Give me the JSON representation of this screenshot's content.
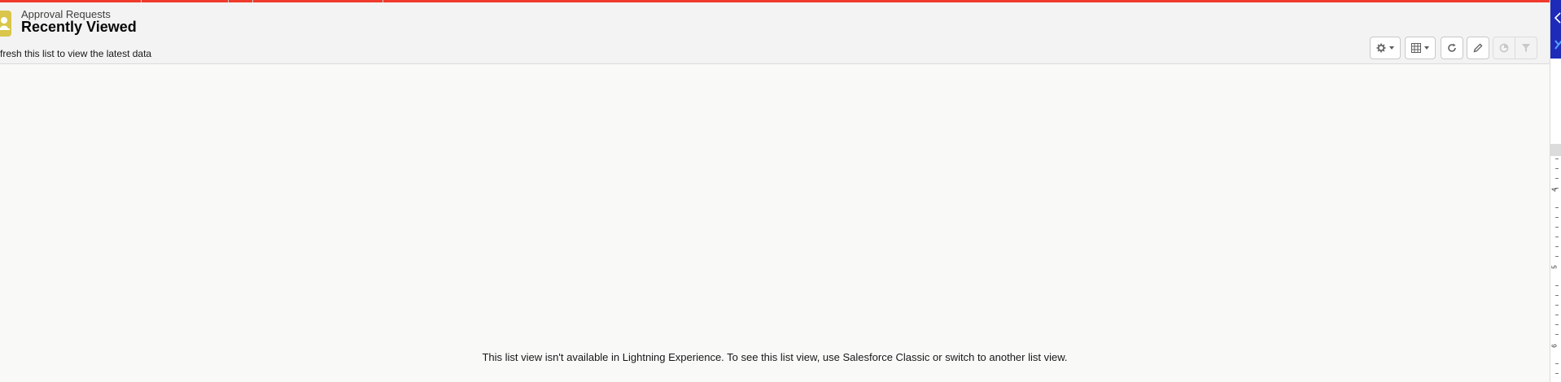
{
  "header": {
    "breadcrumb": "Approval Requests",
    "title": "Recently Viewed",
    "subtitle": "fresh this list to view the latest data",
    "icon": "approval-user-icon",
    "icon_color": "#d9c64a"
  },
  "toolbar": {
    "buttons": [
      {
        "name": "list-view-controls",
        "icon": "gear-icon",
        "has_caret": true
      },
      {
        "name": "display-as",
        "icon": "table-icon",
        "has_caret": true
      },
      {
        "name": "refresh",
        "icon": "refresh-icon"
      },
      {
        "name": "edit-list",
        "icon": "pencil-icon"
      },
      {
        "name": "show-charts",
        "icon": "chart-icon",
        "disabled": true
      },
      {
        "name": "show-filters",
        "icon": "filter-icon",
        "disabled": true
      }
    ]
  },
  "main": {
    "message": "This list view isn't available in Lightning Experience. To see this list view, use Salesforce Classic or switch to another list view."
  },
  "side_ruler": {
    "labels": [
      "4",
      "5",
      "6"
    ]
  },
  "colors": {
    "accent_bar": "#f03a2c",
    "side_panel_block": "#1d2bb8"
  }
}
